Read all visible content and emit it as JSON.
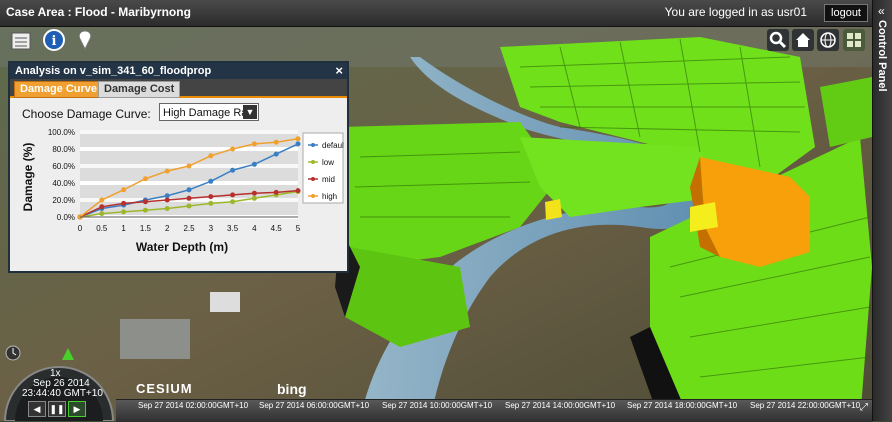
{
  "header": {
    "title": "Case Area : Flood - Maribyrnong",
    "login_text": "You are logged in as usr01",
    "logout_label": "logout"
  },
  "control_panel": {
    "label": "Control Panel",
    "chevron": "«"
  },
  "toolbar": {
    "left_icons": [
      "layers-icon",
      "info-icon",
      "pin-icon"
    ],
    "right_icons": [
      "search-icon",
      "home-icon",
      "globe-icon",
      "grid-icon"
    ]
  },
  "analysis_panel": {
    "title": "Analysis on v_sim_341_60_floodprop",
    "close": "×",
    "tabs": [
      {
        "label": "Damage Curve",
        "active": true
      },
      {
        "label": "Damage Cost",
        "active": false
      }
    ],
    "curve_label": "Choose Damage Curve:",
    "curve_value": "High Damage Rati",
    "select_arrow": "▼"
  },
  "chart_data": {
    "type": "line",
    "xlabel": "Water Depth (m)",
    "ylabel": "Damage (%)",
    "x": [
      0,
      0.5,
      1,
      1.5,
      2,
      2.5,
      3,
      3.5,
      4,
      4.5,
      5
    ],
    "x_tick_labels": [
      "0",
      "0.5",
      "1",
      "1.5",
      "2",
      "2.5",
      "3",
      "3.5",
      "4",
      "4.5",
      "5"
    ],
    "ylim": [
      0,
      100
    ],
    "y_ticks": [
      0,
      20,
      40,
      60,
      80,
      100
    ],
    "y_tick_labels": [
      "0.0%",
      "20.0%",
      "40.0%",
      "60.0%",
      "80.0%",
      "100.0%"
    ],
    "grid": true,
    "legend_position": "right",
    "series": [
      {
        "name": "default",
        "color": "#3a7fc4",
        "values": [
          0,
          10,
          14,
          20,
          25,
          32,
          42,
          55,
          62,
          74,
          86
        ]
      },
      {
        "name": "low",
        "color": "#9cb82a",
        "values": [
          0,
          4,
          6,
          8,
          10,
          13,
          16,
          18,
          22,
          26,
          30
        ]
      },
      {
        "name": "mid",
        "color": "#b8302d",
        "values": [
          0,
          12,
          16,
          18,
          20,
          22,
          24,
          26,
          28,
          29,
          31
        ]
      },
      {
        "name": "high",
        "color": "#f0a030",
        "values": [
          0,
          20,
          32,
          45,
          54,
          60,
          72,
          80,
          86,
          88,
          92
        ]
      }
    ]
  },
  "clock": {
    "speed": "1x",
    "date": "Sep 26 2014",
    "time": "23:44:40 GMT+10"
  },
  "attribution": {
    "cesium": "CESIUM",
    "bing": "bing"
  },
  "timeline": {
    "labels": [
      "Sep 27 2014 02:00:00GMT+10",
      "Sep 27 2014 06:00:00GMT+10",
      "Sep 27 2014 10:00:00GMT+10",
      "Sep 27 2014 14:00:00GMT+10",
      "Sep 27 2014 18:00:00GMT+10",
      "Sep 27 2014 22:00:00GMT+10"
    ]
  }
}
